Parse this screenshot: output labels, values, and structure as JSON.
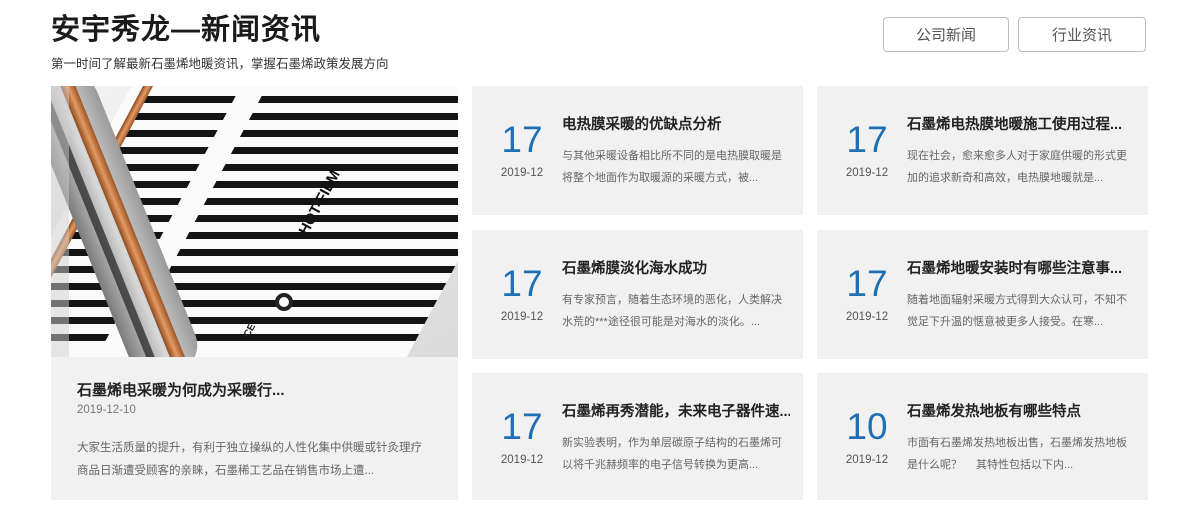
{
  "header": {
    "title": "安宇秀龙—新闻资讯",
    "subtitle": "第一时间了解最新石墨烯地暖资讯，掌握石墨烯政策发展方向",
    "tabs": [
      "公司新闻",
      "行业资讯"
    ]
  },
  "featured": {
    "title": "石墨烯电采暖为何成为采暖行...",
    "date": "2019-12-10",
    "summary": "大家生活质量的提升，有利于独立操纵的人性化集中供暖或针灸理疗商品日渐遭受顾客的亲睐，石墨稀工艺品在销售市场上遭...",
    "image_icon": "heating-film-roll-photo",
    "image_text": "HOT-FILM"
  },
  "cards": [
    {
      "day": "17",
      "ym": "2019-12",
      "title": "电热膜采暖的优缺点分析",
      "summary": "与其他采暖设备相比所不同的是电热膜取暖是将整个地面作为取暖源的采暖方式，被..."
    },
    {
      "day": "17",
      "ym": "2019-12",
      "title": "石墨烯电热膜地暖施工使用过程...",
      "summary": "现在社会，愈来愈多人对于家庭供暖的形式更加的追求新奇和高效，电热膜地暖就是..."
    },
    {
      "day": "17",
      "ym": "2019-12",
      "title": "石墨烯膜淡化海水成功",
      "summary": "有专家预言，随着生态环境的恶化，人类解决水荒的***途径很可能是对海水的淡化。..."
    },
    {
      "day": "17",
      "ym": "2019-12",
      "title": "石墨烯地暖安装时有哪些注意事...",
      "summary": "随着地面辐射采暖方式得到大众认可，不知不觉足下升温的惬意被更多人接受。在寒..."
    },
    {
      "day": "17",
      "ym": "2019-12",
      "title": "石墨烯再秀潜能，未来电子器件速...",
      "summary": "新实验表明，作为单层碳原子结构的石墨烯可以将千兆赫频率的电子信号转换为更高..."
    },
    {
      "day": "10",
      "ym": "2019-12",
      "title": "石墨烯发热地板有哪些特点",
      "summary": "市面有石墨烯发热地板出售，石墨烯发热地板是什么呢？　 其特性包括以下内..."
    }
  ],
  "colors": {
    "accent_blue": "#1f6fb5",
    "card_bg": "#f1f1f1"
  }
}
